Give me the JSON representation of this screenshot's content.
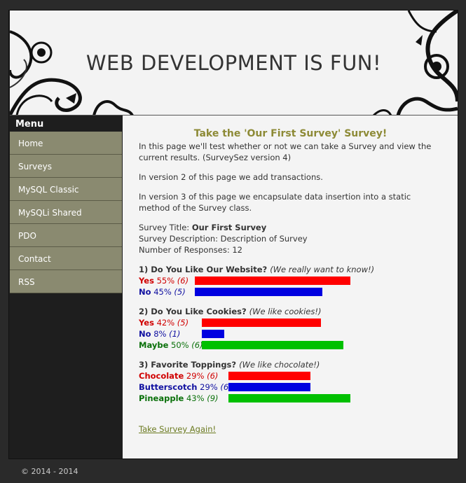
{
  "header": {
    "title": "WEB DEVELOPMENT IS FUN!"
  },
  "menu": {
    "heading": "Menu",
    "items": [
      "Home",
      "Surveys",
      "MySQL Classic",
      "MySQLi Shared",
      "PDO",
      "Contact",
      "RSS"
    ]
  },
  "content": {
    "heading": "Take the 'Our First Survey' Survey!",
    "para1": "In this page we'll test whether or not we can take a Survey and view the current results. (SurveySez version 4)",
    "para2": "In version 2 of this page we add transactions.",
    "para3": "In version 3 of this page we encapsulate data insertion into a static method of the Survey class.",
    "survey_title_label": "Survey Title: ",
    "survey_title": "Our First Survey",
    "survey_desc": "Survey Description: Description of Survey",
    "responses": "Number of Responses: 12",
    "questions": [
      {
        "title": "1) Do You Like Our Website?",
        "note": "(We really want to know!)",
        "answers": [
          {
            "label": "Yes",
            "pct": "55%",
            "count": "(6)",
            "value": 55,
            "color": "red"
          },
          {
            "label": "No",
            "pct": "45%",
            "count": "(5)",
            "value": 45,
            "color": "blue"
          }
        ]
      },
      {
        "title": "2) Do You Like Cookies?",
        "note": "(We like cookies!)",
        "answers": [
          {
            "label": "Yes",
            "pct": "42%",
            "count": "(5)",
            "value": 42,
            "color": "red"
          },
          {
            "label": "No",
            "pct": "8%",
            "count": "(1)",
            "value": 8,
            "color": "blue"
          },
          {
            "label": "Maybe",
            "pct": "50%",
            "count": "(6)",
            "value": 50,
            "color": "green"
          }
        ]
      },
      {
        "title": "3) Favorite Toppings?",
        "note": "(We like chocolate!)",
        "answers": [
          {
            "label": "Chocolate",
            "pct": "29%",
            "count": "(6)",
            "value": 29,
            "color": "red"
          },
          {
            "label": "Butterscotch",
            "pct": "29%",
            "count": "(6)",
            "value": 29,
            "color": "blue"
          },
          {
            "label": "Pineapple",
            "pct": "43%",
            "count": "(9)",
            "value": 43,
            "color": "green"
          }
        ]
      }
    ],
    "again_link": "Take Survey Again!"
  },
  "footer": {
    "text": "© 2014 - 2014"
  }
}
